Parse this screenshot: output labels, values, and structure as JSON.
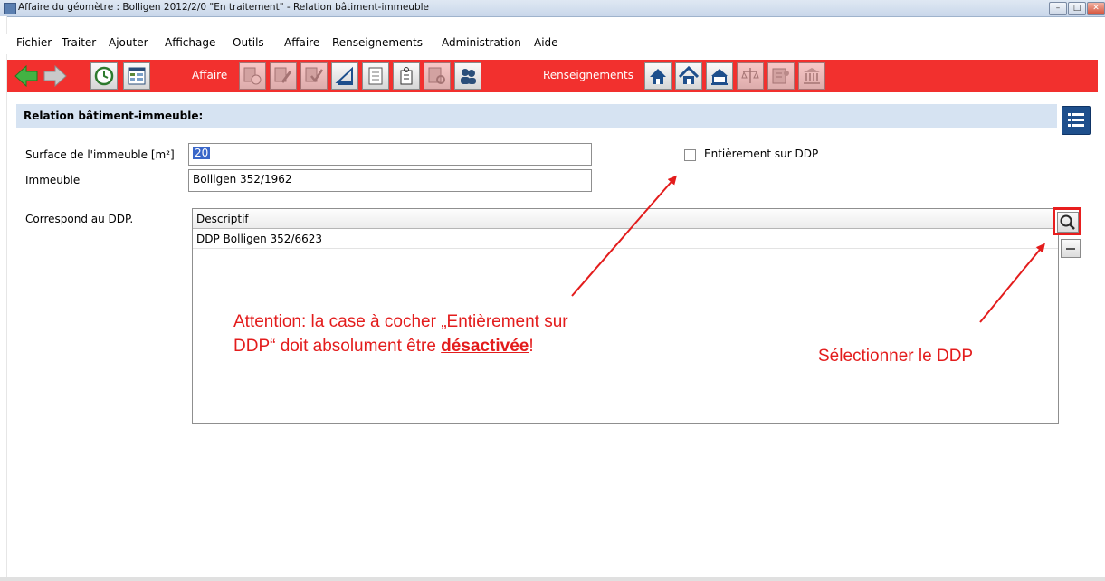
{
  "window": {
    "title": "Affaire du géomètre : Bolligen 2012/2/0 \"En traitement\"  - Relation bâtiment-immeuble",
    "min_glyph": "–",
    "max_glyph": "□",
    "close_glyph": "✕"
  },
  "menu": {
    "items": [
      "Fichier",
      "Traiter",
      "Ajouter",
      "Affichage",
      "Outils",
      "Affaire",
      "Renseignements",
      "Administration",
      "Aide"
    ]
  },
  "toolbar": {
    "affaire_label": "Affaire",
    "renseignements_label": "Renseignements",
    "background": "#f2302e",
    "nav_arrow_color": "#3fae3f",
    "icons": {
      "back": "back-arrow-icon",
      "forward": "forward-arrow-icon",
      "history": "history-clock-icon",
      "table": "table-view-icon",
      "affaire": [
        "affaire-time-icon",
        "affaire-edit-icon",
        "affaire-check-icon",
        "affaire-measure-icon",
        "affaire-document-icon",
        "affaire-tag-icon",
        "affaire-search-doc-icon",
        "affaire-people-icon"
      ],
      "renseignements": [
        "parcel-building-icon",
        "house-icon",
        "building-icon",
        "scales-icon",
        "register-icon",
        "institution-icon"
      ]
    }
  },
  "section": {
    "title": "Relation bâtiment-immeuble:"
  },
  "form": {
    "surface_label": "Surface de l'immeuble [m²]",
    "surface_value": "20",
    "immeuble_label": "Immeuble",
    "immeuble_value": "Bolligen 352/1962",
    "checkbox_label": "Entièrement sur DDP",
    "checkbox_checked": false,
    "ddp_label": "Correspond au DDP."
  },
  "ddp_table": {
    "column": "Descriptif",
    "rows": [
      "DDP Bolligen 352/6623"
    ]
  },
  "annotations": {
    "warning_line1": "Attention: la case à cocher „Entièrement sur",
    "warning_line2_pre": "DDP“ doit absolument être ",
    "warning_line2_em": "désactivée",
    "warning_line2_post": "!",
    "select_note": "Sélectionner le DDP",
    "color": "#e31c1c"
  }
}
